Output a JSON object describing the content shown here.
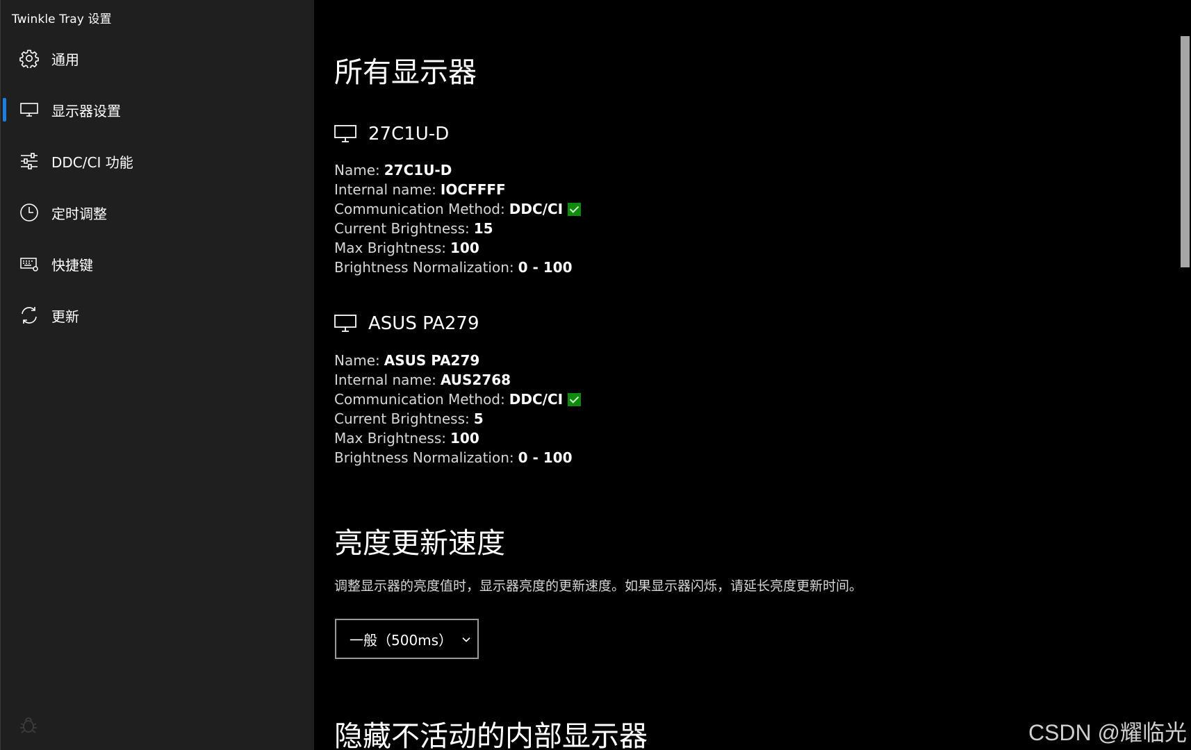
{
  "window": {
    "title": "Twinkle Tray 设置",
    "controls": {
      "minimize_icon": "minimize-icon",
      "maximize_icon": "maximize-icon",
      "close_icon": "close-icon"
    }
  },
  "sidebar": {
    "items": [
      {
        "label": "通用",
        "icon": "gear-icon",
        "active": false
      },
      {
        "label": "显示器设置",
        "icon": "monitor-icon",
        "active": true
      },
      {
        "label": "DDC/CI 功能",
        "icon": "sliders-icon",
        "active": false
      },
      {
        "label": "定时调整",
        "icon": "clock-icon",
        "active": false
      },
      {
        "label": "快捷键",
        "icon": "keyboard-icon",
        "active": false
      },
      {
        "label": "更新",
        "icon": "refresh-icon",
        "active": false
      }
    ],
    "footer_icon": "bug-icon",
    "accent_color": "#1a7fdd"
  },
  "main": {
    "all_monitors_title": "所有显示器",
    "labels": {
      "name": "Name",
      "internal_name": "Internal name",
      "comm_method": "Communication Method",
      "current_brightness": "Current Brightness",
      "max_brightness": "Max Brightness",
      "normalization": "Brightness Normalization",
      "colon": ":"
    },
    "monitors": [
      {
        "title": "27C1U-D",
        "name": "27C1U-D",
        "internal_name": "IOCFFFF",
        "comm_method": "DDC/CI",
        "comm_ok": true,
        "current_brightness": "15",
        "max_brightness": "100",
        "normalization": "0 - 100"
      },
      {
        "title": "ASUS PA279",
        "name": "ASUS PA279",
        "internal_name": "AUS2768",
        "comm_method": "DDC/CI",
        "comm_ok": true,
        "current_brightness": "5",
        "max_brightness": "100",
        "normalization": "0 - 100"
      }
    ],
    "update_speed": {
      "title": "亮度更新速度",
      "description": "调整显示器的亮度值时，显示器亮度的更新速度。如果显示器闪烁，请延长亮度更新时间。",
      "selected": "一般（500ms）"
    },
    "hide_internal_title": "隐藏不活动的内部显示器",
    "check_color": "#0f8a0f"
  },
  "watermark": "CSDN @耀临光"
}
